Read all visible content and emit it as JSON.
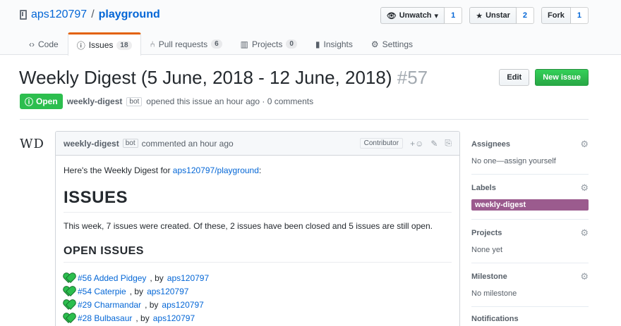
{
  "repo": {
    "owner": "aps120797",
    "separator": "/",
    "name": "playground"
  },
  "actions": {
    "watch": {
      "label": "Unwatch",
      "count": "1"
    },
    "star": {
      "label": "Unstar",
      "count": "2"
    },
    "fork": {
      "label": "Fork",
      "count": "1"
    }
  },
  "tabs": [
    {
      "label": "Code",
      "counter": ""
    },
    {
      "label": "Issues",
      "counter": "18"
    },
    {
      "label": "Pull requests",
      "counter": "6"
    },
    {
      "label": "Projects",
      "counter": "0"
    },
    {
      "label": "Insights",
      "counter": ""
    },
    {
      "label": "Settings",
      "counter": ""
    }
  ],
  "issue": {
    "title": "Weekly Digest (5 June, 2018 - 12 June, 2018)",
    "number": "#57",
    "state": "Open",
    "author": "weekly-digest",
    "author_badge": "bot",
    "meta_text": "opened this issue an hour ago · 0 comments",
    "edit_label": "Edit",
    "new_issue_label": "New issue"
  },
  "avatar": {
    "initials": "WD"
  },
  "comment": {
    "author": "weekly-digest",
    "author_badge": "bot",
    "time_text": "commented an hour ago",
    "role": "Contributor",
    "intro_text": "Here's the Weekly Digest for ",
    "intro_link": "aps120797/playground",
    "intro_suffix": ":",
    "heading": "ISSUES",
    "summary": "This week, 7 issues were created. Of these, 2 issues have been closed and 5 issues are still open.",
    "subheading": "OPEN ISSUES",
    "open_issues": [
      {
        "link": "#56 Added Pidgey",
        "by": ", by ",
        "user": "aps120797"
      },
      {
        "link": "#54 Caterpie",
        "by": ", by ",
        "user": "aps120797"
      },
      {
        "link": "#29 Charmandar",
        "by": ", by ",
        "user": "aps120797"
      },
      {
        "link": "#28 Bulbasaur",
        "by": ", by ",
        "user": "aps120797"
      }
    ]
  },
  "sidebar": {
    "assignees": {
      "title": "Assignees",
      "value": "No one—assign yourself"
    },
    "labels": {
      "title": "Labels",
      "label": "weekly-digest",
      "label_color": "#9b5b8e"
    },
    "projects": {
      "title": "Projects",
      "value": "None yet"
    },
    "milestone": {
      "title": "Milestone",
      "value": "No milestone"
    },
    "notifications": {
      "title": "Notifications"
    }
  }
}
